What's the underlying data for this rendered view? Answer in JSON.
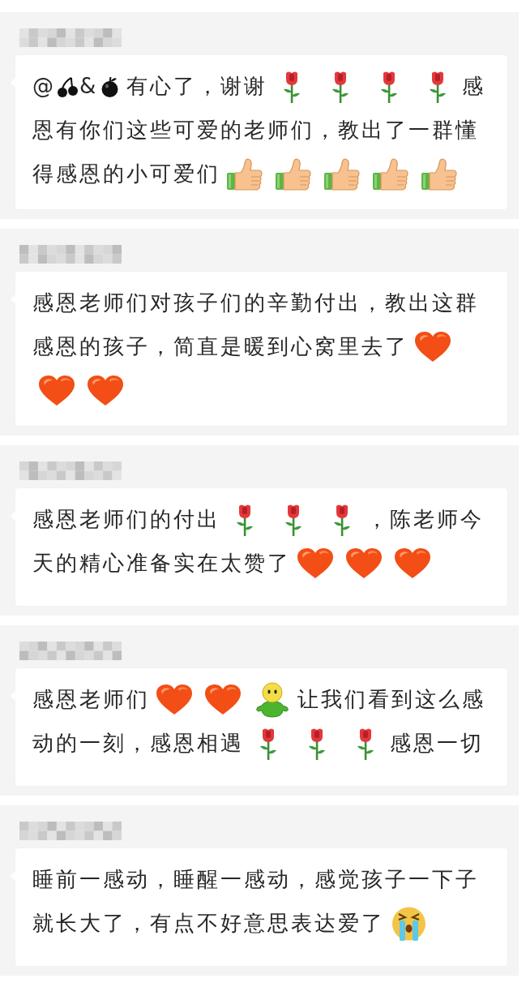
{
  "messages": [
    {
      "lines": [
        [
          {
            "kind": "text",
            "text": "@"
          },
          {
            "kind": "cherry"
          },
          {
            "kind": "text",
            "text": "&"
          },
          {
            "kind": "apple"
          },
          {
            "kind": "text",
            "text": "有心了，谢谢"
          },
          {
            "kind": "rose"
          },
          {
            "kind": "rose"
          },
          {
            "kind": "rose"
          },
          {
            "kind": "rose"
          },
          {
            "kind": "text",
            "text": "感"
          }
        ],
        [
          {
            "kind": "text",
            "text": "恩有你们这些可爱的老师们，教出了一群懂"
          }
        ],
        [
          {
            "kind": "text",
            "text": "得感恩的小可爱们"
          },
          {
            "kind": "thumb"
          },
          {
            "kind": "thumb"
          },
          {
            "kind": "thumb"
          },
          {
            "kind": "thumb"
          },
          {
            "kind": "thumb"
          }
        ]
      ]
    },
    {
      "lines": [
        [
          {
            "kind": "text",
            "text": "感恩老师们对孩子们的辛勤付出，教出这群"
          }
        ],
        [
          {
            "kind": "text",
            "text": "感恩的孩子，简直是暖到心窝里去了"
          },
          {
            "kind": "heart"
          }
        ],
        [
          {
            "kind": "heart"
          },
          {
            "kind": "heart"
          }
        ]
      ]
    },
    {
      "lines": [
        [
          {
            "kind": "text",
            "text": "感恩老师们的付出"
          },
          {
            "kind": "rose"
          },
          {
            "kind": "rose"
          },
          {
            "kind": "rose"
          },
          {
            "kind": "text",
            "text": "，陈老师今"
          }
        ],
        [
          {
            "kind": "text",
            "text": "天的精心准备实在太赞了"
          },
          {
            "kind": "heart"
          },
          {
            "kind": "heart"
          },
          {
            "kind": "heart"
          }
        ]
      ]
    },
    {
      "lines": [
        [
          {
            "kind": "text",
            "text": "感恩老师们"
          },
          {
            "kind": "heart"
          },
          {
            "kind": "heart"
          },
          {
            "kind": "figure"
          },
          {
            "kind": "text",
            "text": "让我们看到这么感"
          }
        ],
        [
          {
            "kind": "text",
            "text": "动的一刻，感恩相遇"
          },
          {
            "kind": "rose"
          },
          {
            "kind": "rose"
          },
          {
            "kind": "rose"
          },
          {
            "kind": "text",
            "text": "感恩一切"
          }
        ]
      ]
    },
    {
      "lines": [
        [
          {
            "kind": "text",
            "text": "睡前一感动，睡醒一感动，感觉孩子一下子"
          }
        ],
        [
          {
            "kind": "text",
            "text": "就长大了，有点不好意思表达爱了"
          },
          {
            "kind": "crying"
          }
        ]
      ]
    }
  ]
}
